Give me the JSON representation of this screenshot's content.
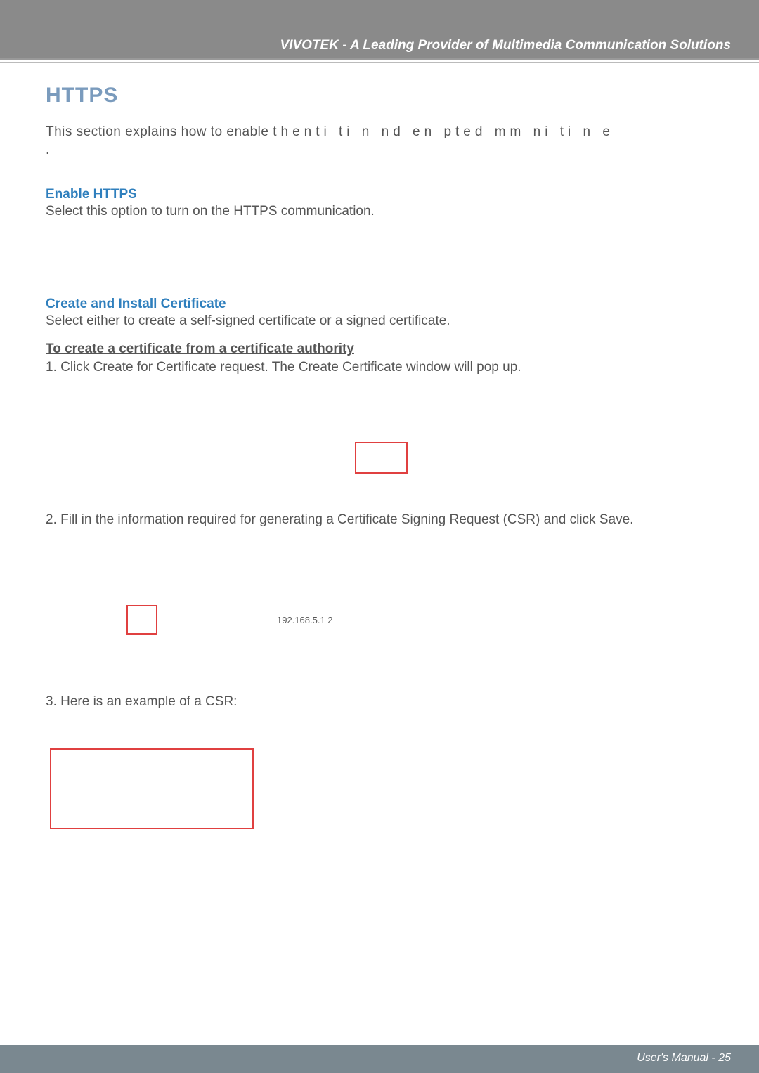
{
  "header": {
    "brand_line": "VIVOTEK - A Leading Provider of Multimedia Communication Solutions"
  },
  "page": {
    "title": "HTTPS",
    "intro_prefix": "This section explains how to enable",
    "intro_spaced": "  thenti   ti n   nd en    pted    mm  ni   ti n    e",
    "intro_suffix": "          .",
    "enable": {
      "heading": "Enable HTTPS",
      "body": "Select this option to turn on the HTTPS communication."
    },
    "create_install": {
      "heading": "Create and Install Certificate",
      "body": "Select either to create a self-signed certificate or a signed certificate."
    },
    "cert_authority_heading": "To create a certificate from a certificate authority",
    "step1": "1. Click Create for Certificate request. The Create Certificate window will pop up.",
    "step2": "2. Fill in the information required for generating a Certificate Signing Request (CSR) and click Save.",
    "ip_example": "192.168.5.1  2",
    "step3": "3. Here is an example of a CSR:"
  },
  "footer": {
    "label": "User's Manual - ",
    "page_number": "25"
  }
}
